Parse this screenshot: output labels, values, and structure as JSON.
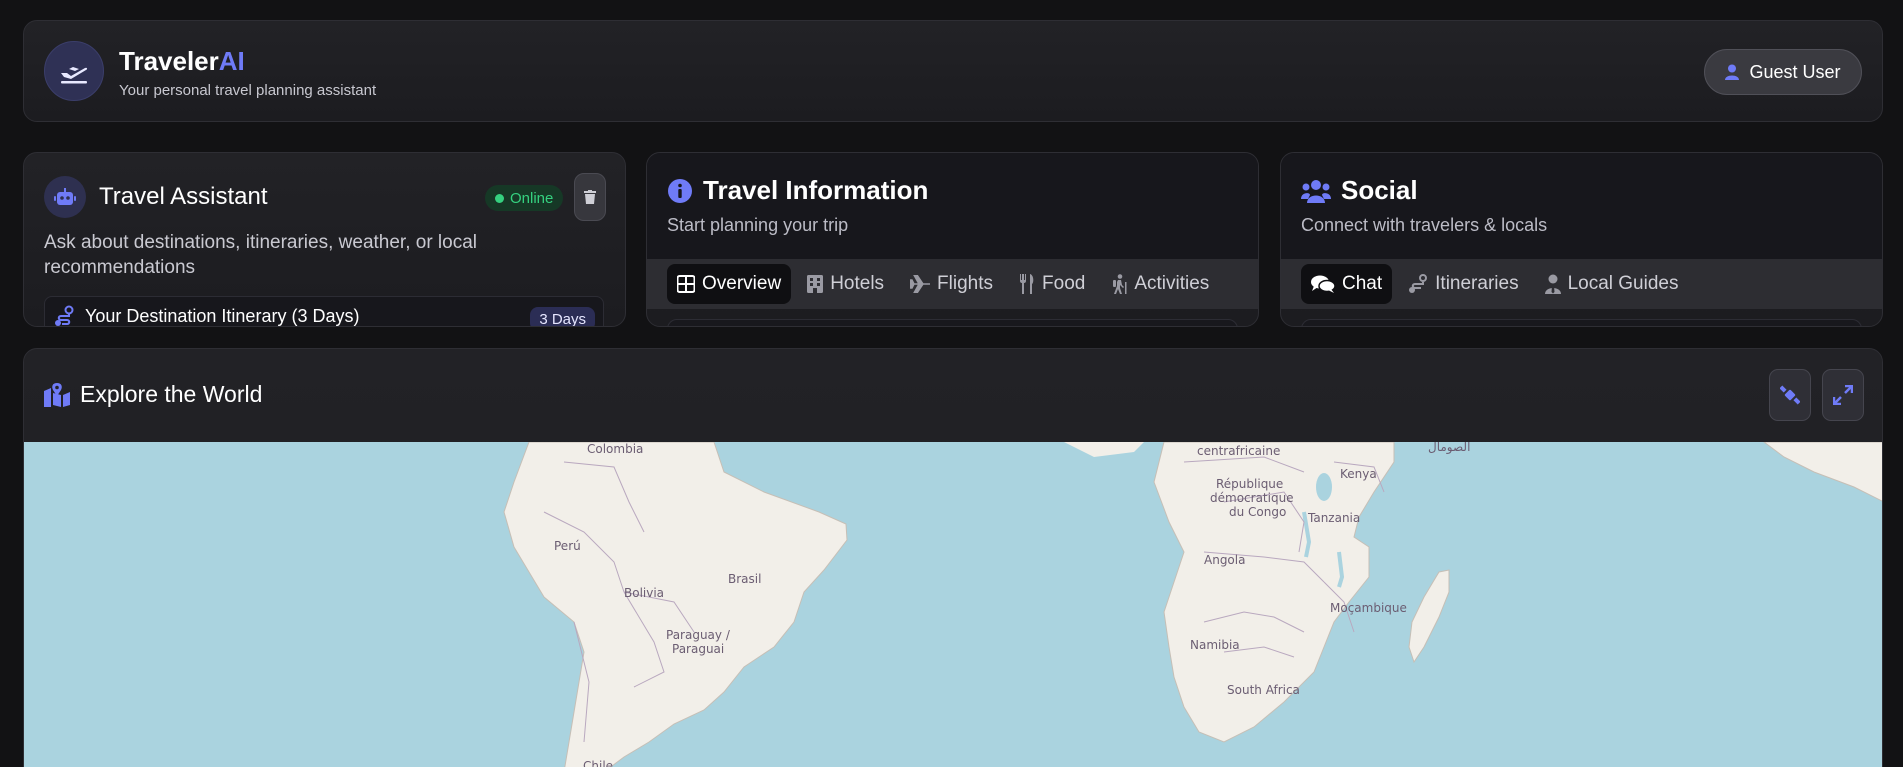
{
  "header": {
    "brand_main": "Traveler",
    "brand_accent": "AI",
    "tagline": "Your personal travel planning assistant",
    "user_button": "Guest User",
    "icons": [
      "plane-departure-icon",
      "user-icon"
    ]
  },
  "assistant": {
    "title": "Travel Assistant",
    "status": "Online",
    "description": "Ask about destinations, itineraries, weather, or local recommendations",
    "itinerary": {
      "title": "Your Destination Itinerary (3 Days)",
      "badge": "3 Days"
    },
    "icons": [
      "robot-icon",
      "trash-icon",
      "route-icon"
    ]
  },
  "travel_info": {
    "title": "Travel Information",
    "subtitle": "Start planning your trip",
    "tabs": [
      {
        "label": "Overview",
        "icon": "grid-icon",
        "active": true
      },
      {
        "label": "Hotels",
        "icon": "hotel-icon",
        "active": false
      },
      {
        "label": "Flights",
        "icon": "plane-icon",
        "active": false
      },
      {
        "label": "Food",
        "icon": "utensils-icon",
        "active": false
      },
      {
        "label": "Activities",
        "icon": "hiking-icon",
        "active": false
      }
    ]
  },
  "social": {
    "title": "Social",
    "subtitle": "Connect with travelers & locals",
    "tabs": [
      {
        "label": "Chat",
        "icon": "comments-icon",
        "active": true
      },
      {
        "label": "Itineraries",
        "icon": "route-icon",
        "active": false
      },
      {
        "label": "Local Guides",
        "icon": "user-tie-icon",
        "active": false
      }
    ]
  },
  "map": {
    "title": "Explore the World",
    "buttons": [
      "satellite-icon",
      "expand-icon"
    ],
    "labels": {
      "colombia": "Colombia",
      "peru": "Perú",
      "bolivia": "Bolivia",
      "brasil": "Brasil",
      "paraguay_1": "Paraguay /",
      "paraguay_2": "Paraguai",
      "chile": "Chile",
      "centrafricaine": "centrafricaine",
      "somalia": "الصومال",
      "kenya": "Kenya",
      "rdc_1": "République",
      "rdc_2": "démocratique",
      "rdc_3": "du Congo",
      "tanzania": "Tanzania",
      "angola": "Angola",
      "mocambique": "Moçambique",
      "namibia": "Namibia",
      "south_africa": "South Africa"
    },
    "colors": {
      "ocean": "#aad3df",
      "land": "#f2efe9",
      "border": "#9b8ea3"
    }
  }
}
